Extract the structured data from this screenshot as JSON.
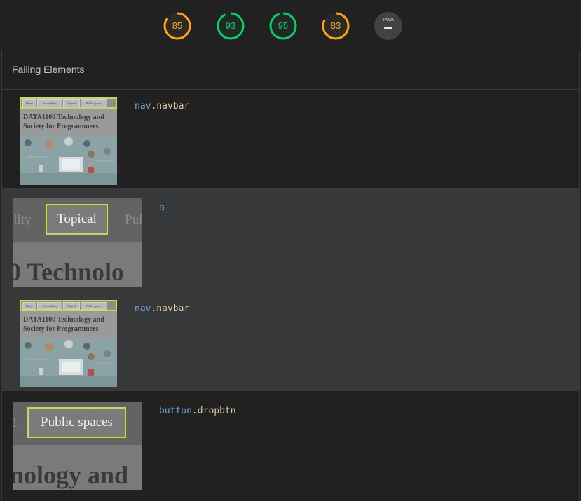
{
  "scores": [
    {
      "value": "85",
      "fraction": 0.85,
      "color": "#ffa31a"
    },
    {
      "value": "93",
      "fraction": 0.93,
      "color": "#0cce6b"
    },
    {
      "value": "95",
      "fraction": 0.95,
      "color": "#0cce6b"
    },
    {
      "value": "83",
      "fraction": 0.83,
      "color": "#ffa31a"
    }
  ],
  "pwa": {
    "label": "PWA",
    "icon": "dash-icon"
  },
  "panel": {
    "title": "Failing Elements"
  },
  "thumbnail": {
    "nav_links": [
      "Home",
      "Accessibility",
      "Topical",
      "Public spaces"
    ],
    "site_title_line1": "DATA1100 Technology and",
    "site_title_line2": "Society for Programmers"
  },
  "rows": [
    {
      "tag": "nav",
      "cls": ".navbar"
    },
    {
      "tag": "a",
      "cls": "",
      "zoom": {
        "ghost_left": "ility",
        "button": "Topical",
        "ghost_right": "Pul",
        "big_text": "0 Technolo"
      }
    },
    {
      "tag": "nav",
      "cls": ".navbar"
    },
    {
      "tag": "button",
      "cls": ".dropbtn",
      "zoom": {
        "ghost_left": "1",
        "button": "Public spaces",
        "ghost_right": "",
        "big_text": "nology and"
      }
    }
  ]
}
